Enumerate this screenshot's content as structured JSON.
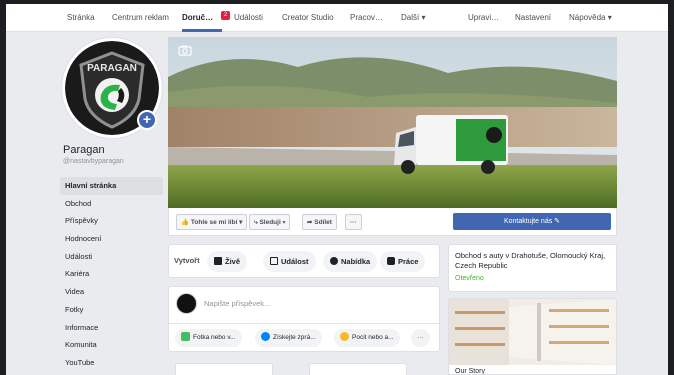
{
  "topnav": {
    "items": [
      "Stránka",
      "Centrum reklam",
      "Doruč…",
      "Události",
      "Creator Studio",
      "Pracov…",
      "Další ▾",
      "Upravi…",
      "Nastavení",
      "Nápověda ▾"
    ],
    "badge": "2"
  },
  "profile": {
    "logo_text": "PARAGAN",
    "name": "Paragan",
    "handle": "@nastavbyparagan"
  },
  "left_nav": [
    "Hlavní stránka",
    "Obchod",
    "Příspěvky",
    "Hodnocení",
    "Události",
    "Kariéra",
    "Videa",
    "Fotky",
    "Informace",
    "Komunita",
    "YouTube"
  ],
  "actions": {
    "like": "Tohle se mi líbí ▾",
    "follow": "Sleduji ▾",
    "share": "Sdílet",
    "more": "···",
    "contact": "Kontaktujte nás ✎"
  },
  "create": {
    "label": "Vytvořt",
    "live": "Živě",
    "event": "Událost",
    "offer": "Nabídka",
    "jobs": "Práce"
  },
  "composer": {
    "placeholder": "Napište příspěvek...",
    "photo": "Fotka nebo v...",
    "message": "Získejte zprá...",
    "feeling": "Pocit nebo a...",
    "more": "···"
  },
  "info": {
    "address": "Obchod s auty v Drahotuše, Olomoucký Kraj, Czech Republic",
    "status": "Otevřeno"
  },
  "story": {
    "title": "Our Story"
  },
  "colors": {
    "accent": "#4267b2",
    "badge": "#e41e3f",
    "open": "#42b72a"
  }
}
